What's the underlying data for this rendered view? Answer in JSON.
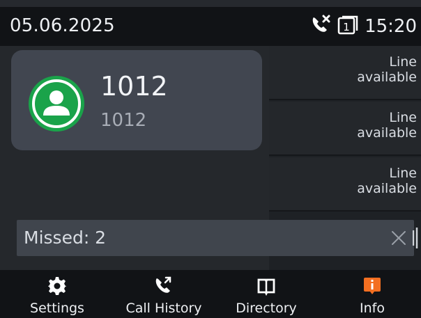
{
  "status_bar": {
    "date": "05.06.2025",
    "time": "15:20",
    "icons": [
      "missed-call-icon",
      "line-1-icon"
    ],
    "line_badge": "1"
  },
  "account": {
    "name": "1012",
    "number": "1012",
    "status_color": "#1aa34a",
    "icon": "user-avatar-icon"
  },
  "lines": [
    {
      "label_1": "Line",
      "label_2": "available"
    },
    {
      "label_1": "Line",
      "label_2": "available"
    },
    {
      "label_1": "Line",
      "label_2": "available"
    }
  ],
  "missed": {
    "text": "Missed: 2",
    "close_icon": "close-icon"
  },
  "nav": {
    "settings": {
      "label": "Settings",
      "icon": "gear-icon"
    },
    "call_history": {
      "label": "Call History",
      "icon": "call-history-icon"
    },
    "directory": {
      "label": "Directory",
      "icon": "book-icon"
    },
    "info": {
      "label": "Info",
      "icon": "info-icon",
      "accent": "#f36f21"
    }
  }
}
